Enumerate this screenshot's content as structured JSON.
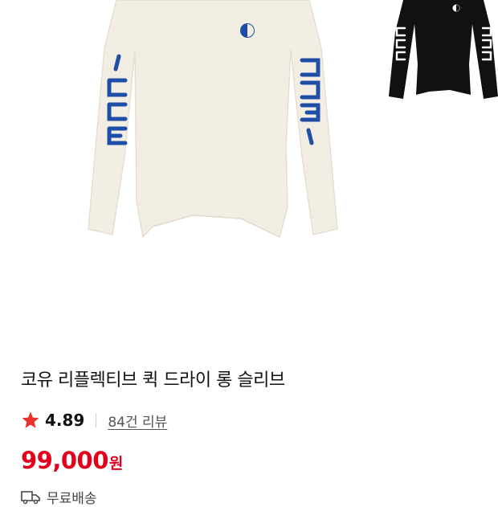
{
  "product": {
    "title": "코유 리플렉티브 퀵 드라이 롱 슬리브",
    "rating": "4.89",
    "review_link": "84건 리뷰",
    "price": "99,000",
    "price_unit": "원",
    "shipping": "무료배송"
  },
  "icons": {
    "rating": "star-icon",
    "shipping": "truck-icon"
  },
  "colors": {
    "price": "#e2001a",
    "star": "#e8322b",
    "sleeve_print": "#1f4ea8",
    "main_shirt": "#f3eee4",
    "alt_shirt": "#111111"
  }
}
